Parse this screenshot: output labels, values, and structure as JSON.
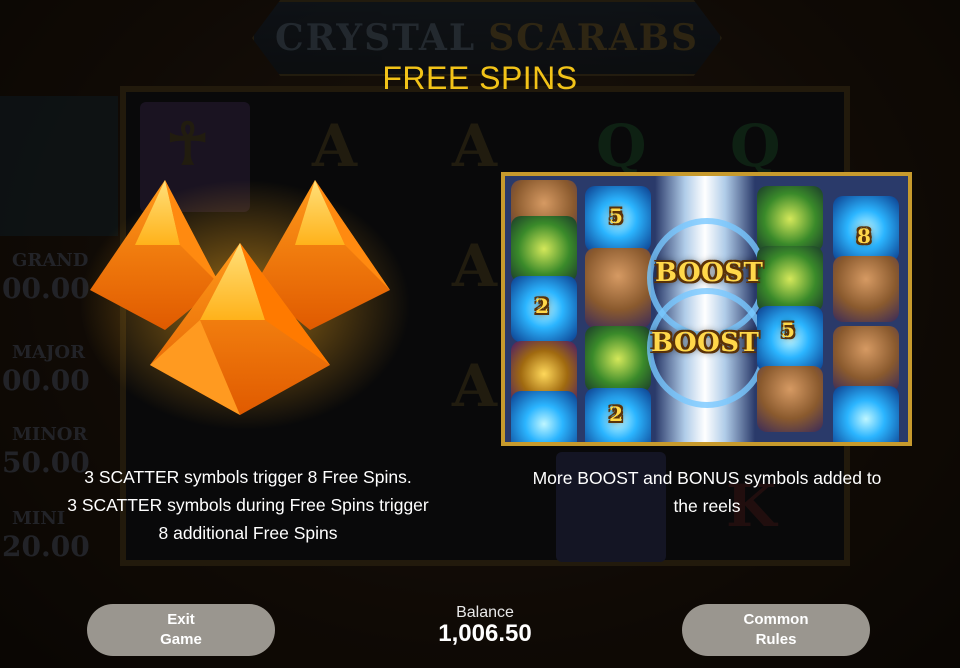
{
  "game": {
    "logo_part1": "CRYSTAL",
    "logo_part2": "SCARABS",
    "jackpots": [
      {
        "label": "GRAND",
        "value": "00.00"
      },
      {
        "label": "MAJOR",
        "value": "00.00"
      },
      {
        "label": "MINOR",
        "value": "50.00"
      },
      {
        "label": "MINI",
        "value": "20.00"
      }
    ]
  },
  "panel": {
    "title": "FREE SPINS",
    "left_description": [
      "3 SCATTER symbols trigger 8 Free Spins.",
      "3 SCATTER symbols during Free Spins trigger",
      "8 additional Free Spins"
    ],
    "right_description": [
      "More BOOST and BONUS symbols added to",
      "the reels"
    ],
    "preview_boost_labels": [
      "BOOST",
      "BOOST"
    ],
    "preview_numbers": [
      "5",
      "8",
      "2",
      "5",
      "2"
    ]
  },
  "footer": {
    "exit_line1": "Exit",
    "exit_line2": "Game",
    "balance_label": "Balance",
    "balance_value": "1,006.50",
    "rules_line1": "Common",
    "rules_line2": "Rules"
  },
  "colors": {
    "title": "#f2c318",
    "button_bg": "#9a968f",
    "preview_border": "#c79a2d"
  }
}
